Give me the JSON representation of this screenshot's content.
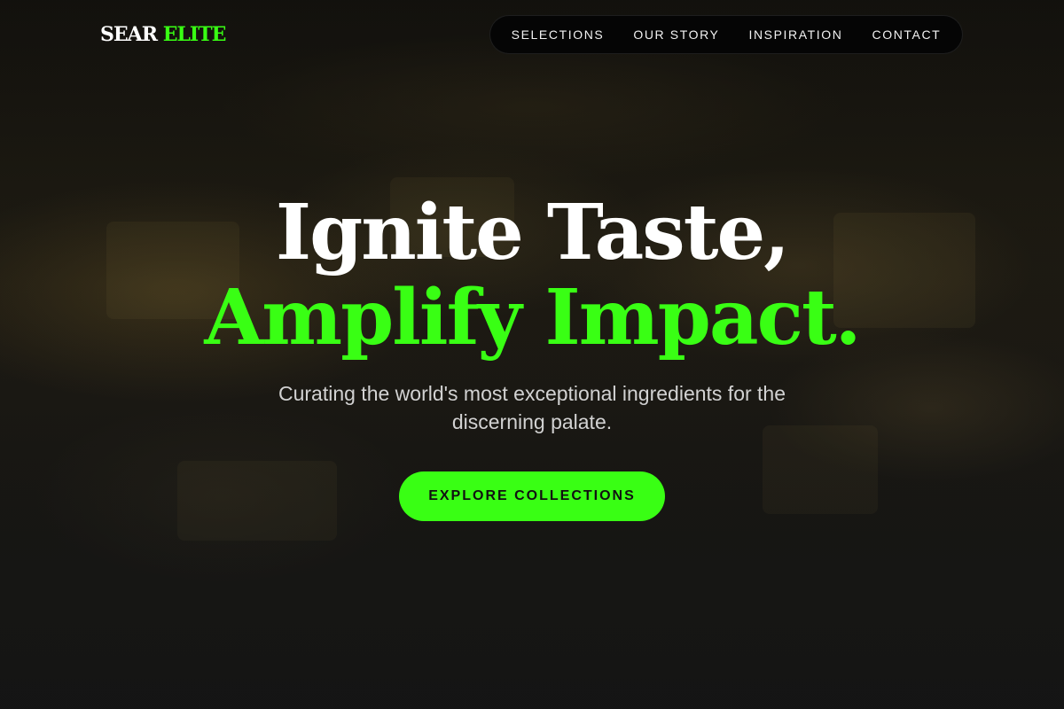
{
  "header": {
    "logo": {
      "primary": "SEAR",
      "accent": "ELITE"
    },
    "nav": {
      "items": [
        {
          "label": "SELECTIONS"
        },
        {
          "label": "OUR STORY"
        },
        {
          "label": "INSPIRATION"
        },
        {
          "label": "CONTACT"
        }
      ]
    }
  },
  "hero": {
    "headline_line1": "Ignite Taste,",
    "headline_line2": "Amplify Impact.",
    "subtitle": "Curating the world's most exceptional ingredients for the discerning palate.",
    "cta_label": "EXPLORE COLLECTIONS"
  },
  "colors": {
    "accent": "#39ff14",
    "background": "#141414",
    "nav_background": "#050505",
    "text_primary": "#ffffff",
    "text_secondary": "#d2d2d2"
  }
}
